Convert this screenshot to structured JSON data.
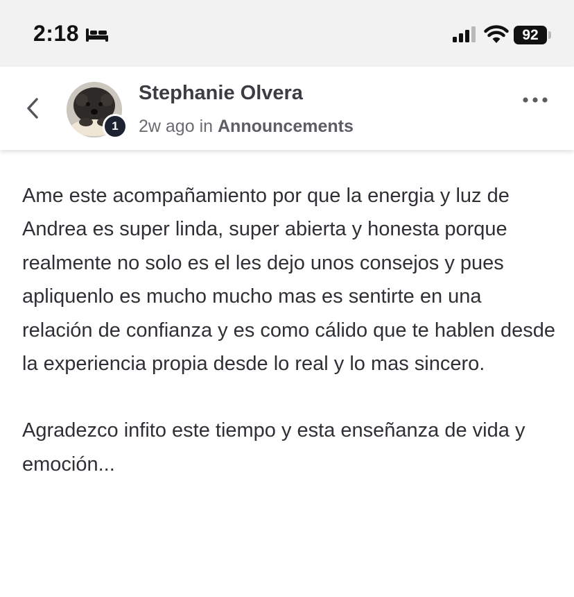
{
  "status_bar": {
    "time": "2:18",
    "battery": "92",
    "icons": [
      "sleep-bed-icon",
      "cellular-signal-icon",
      "wifi-icon",
      "battery-icon"
    ]
  },
  "header": {
    "author": "Stephanie Olvera",
    "badge_count": "1",
    "time_ago": "2w ago",
    "in_label": "in",
    "category": "Announcements",
    "icons": [
      "back-chevron-icon",
      "more-options-icon"
    ]
  },
  "post": {
    "paragraphs": [
      "Ame este acompañamiento por que la energia y luz de Andrea es super linda, super abierta y honesta porque realmente no solo es el les dejo unos consejos y pues apliquenlo es mucho mucho mas es sentirte en una relación de confianza y es como cálido que te hablen desde la experiencia propia desde lo real y lo mas sincero.",
      "Agradezco infito este tiempo y esta enseñanza de vida y emoción..."
    ]
  },
  "colors": {
    "status_bar_bg": "#f2f2f3",
    "badge_bg": "#1c2230",
    "text": "#2f2f35",
    "meta_text": "#6b6b72"
  }
}
